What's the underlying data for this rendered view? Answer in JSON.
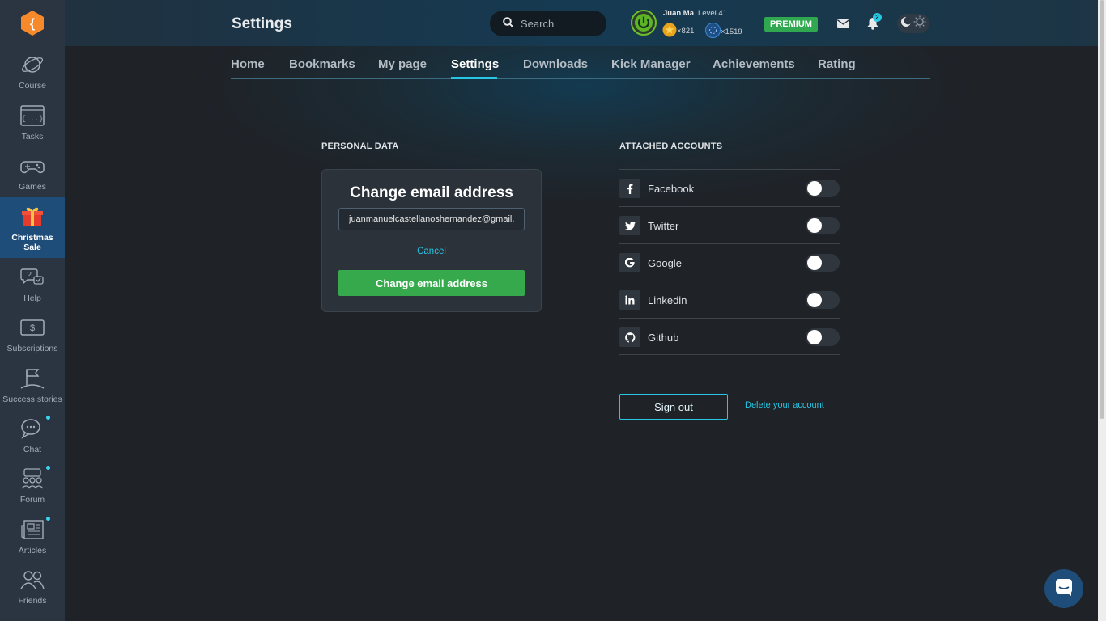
{
  "header": {
    "title": "Settings",
    "search_placeholder": "Search",
    "user": {
      "name": "Juan Ma",
      "level": "Level 41",
      "coins": "×821",
      "xp": "×1519"
    },
    "premium_label": "PREMIUM",
    "notifications_count": "2"
  },
  "sidebar": {
    "items": [
      {
        "label": "Course",
        "icon": "planet-icon"
      },
      {
        "label": "Tasks",
        "icon": "code-braces-icon"
      },
      {
        "label": "Games",
        "icon": "gamepad-icon"
      },
      {
        "label": "Christmas Sale",
        "icon": "gift-icon"
      },
      {
        "label": "Help",
        "icon": "help-bubble-icon"
      },
      {
        "label": "Subscriptions",
        "icon": "dollar-bill-icon"
      },
      {
        "label": "Success stories",
        "icon": "flag-icon"
      },
      {
        "label": "Chat",
        "icon": "chat-icon"
      },
      {
        "label": "Forum",
        "icon": "forum-people-icon"
      },
      {
        "label": "Articles",
        "icon": "newspaper-icon"
      },
      {
        "label": "Friends",
        "icon": "friends-icon"
      }
    ]
  },
  "tabs": [
    {
      "label": "Home"
    },
    {
      "label": "Bookmarks"
    },
    {
      "label": "My page"
    },
    {
      "label": "Settings"
    },
    {
      "label": "Downloads"
    },
    {
      "label": "Kick Manager"
    },
    {
      "label": "Achievements"
    },
    {
      "label": "Rating"
    }
  ],
  "personal": {
    "section_title": "PERSONAL DATA",
    "card_title": "Change email address",
    "email_value": "juanmanuelcastellanoshernandez@gmail.com",
    "cancel_label": "Cancel",
    "submit_label": "Change email address"
  },
  "accounts": {
    "section_title": "ATTACHED ACCOUNTS",
    "items": [
      {
        "name": "Facebook",
        "icon": "facebook-icon",
        "enabled": false
      },
      {
        "name": "Twitter",
        "icon": "twitter-icon",
        "enabled": false
      },
      {
        "name": "Google",
        "icon": "google-icon",
        "enabled": false
      },
      {
        "name": "Linkedin",
        "icon": "linkedin-icon",
        "enabled": false
      },
      {
        "name": "Github",
        "icon": "github-icon",
        "enabled": false
      }
    ]
  },
  "actions": {
    "signout_label": "Sign out",
    "delete_label": "Delete your account"
  },
  "colors": {
    "accent": "#26c6e4",
    "premium": "#2fa84f",
    "sidebar_bg": "#2b3542",
    "page_bg": "#1f2227"
  }
}
